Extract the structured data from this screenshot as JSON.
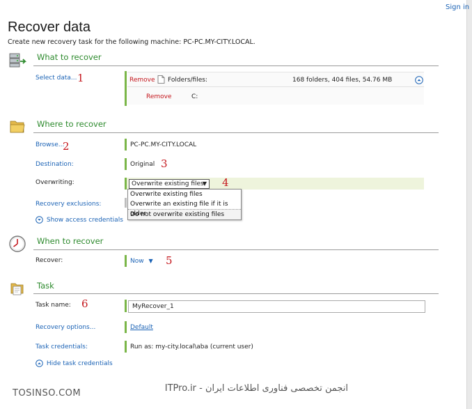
{
  "header": {
    "sign_in": "Sign in"
  },
  "page": {
    "title": "Recover data",
    "subtitle": "Create new recovery task for the following machine: PC-PC.MY-CITY.LOCAL."
  },
  "what": {
    "title": "What to recover",
    "select_link": "Select data...",
    "num1": "1",
    "remove1": "Remove",
    "folders_label": "Folders/files:",
    "folders_summary": "168 folders, 404 files, 54.76 MB",
    "remove2": "Remove",
    "drive": "C:"
  },
  "where": {
    "title": "Where to recover",
    "browse_link": "Browse...",
    "num2": "2",
    "machine": "PC-PC.MY-CITY.LOCAL",
    "destination_link": "Destination:",
    "destination_value": "Original",
    "num3": "3",
    "overwriting_label": "Overwriting:",
    "overwriting_value": "Overwrite existing files",
    "num4": "4",
    "options": [
      "Overwrite existing files",
      "Overwrite an existing file if it is older",
      "Do not overwrite existing files"
    ],
    "exclusions_link": "Recovery exclusions:",
    "show_credentials": "Show access credentials"
  },
  "when": {
    "title": "When to recover",
    "recover_label": "Recover:",
    "recover_value": "Now",
    "num5": "5"
  },
  "task": {
    "title": "Task",
    "name_label": "Task name:",
    "num6": "6",
    "name_value": "MyRecover_1",
    "options_link": "Recovery options...",
    "options_value": "Default",
    "credentials_link": "Task credentials:",
    "credentials_value": "Run as: my-city.local\\aba (current user)",
    "hide_credentials": "Hide task credentials"
  },
  "watermark": {
    "left": "TOSINSO.COM",
    "right": "انجمن تخصصی فناوری اطلاعات ایران - ITPro.ir"
  }
}
